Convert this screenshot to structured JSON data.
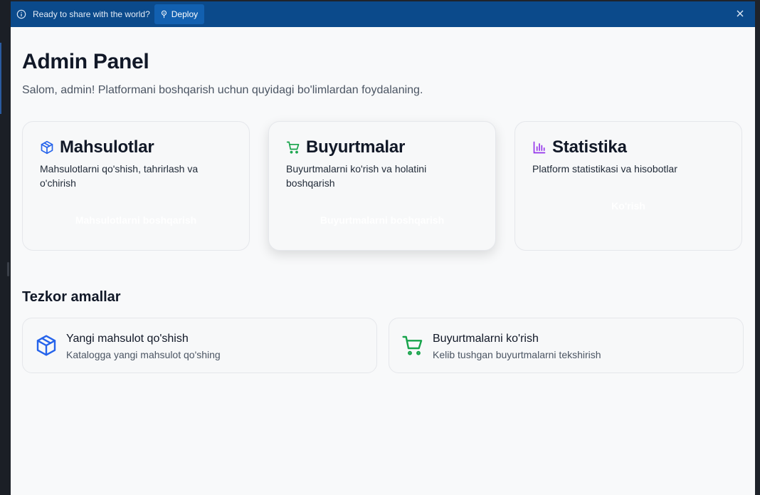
{
  "banner": {
    "message": "Ready to share with the world?",
    "deploy_label": "Deploy",
    "icons": {
      "info": "info-icon",
      "deploy": "pin-icon",
      "close": "close-icon"
    }
  },
  "page": {
    "title": "Admin Panel",
    "subtitle": "Salom, admin! Platformani boshqarish uchun quyidagi bo'limlardan foydalaning."
  },
  "cards": [
    {
      "title": "Mahsulotlar",
      "description": "Mahsulotlarni qo'shish, tahrirlash va o'chirish",
      "action": "Mahsulotlarni boshqarish",
      "icon": "box-icon",
      "color": "#2563eb"
    },
    {
      "title": "Buyurtmalar",
      "description": "Buyurtmalarni ko'rish va holatini boshqarish",
      "action": "Buyurtmalarni boshqarish",
      "icon": "cart-icon",
      "color": "#16a34a"
    },
    {
      "title": "Statistika",
      "description": "Platform statistikasi va hisobotlar",
      "action": "Ko'rish",
      "icon": "bar-chart-icon",
      "color": "#9333ea"
    }
  ],
  "quick_actions": {
    "title": "Tezkor amallar",
    "items": [
      {
        "title": "Yangi mahsulot qo'shish",
        "description": "Katalogga yangi mahsulot qo'shing",
        "icon": "box-icon",
        "color": "#2563eb"
      },
      {
        "title": "Buyurtmalarni ko'rish",
        "description": "Kelib tushgan buyurtmalarni tekshirish",
        "icon": "cart-icon",
        "color": "#16a34a"
      }
    ]
  }
}
